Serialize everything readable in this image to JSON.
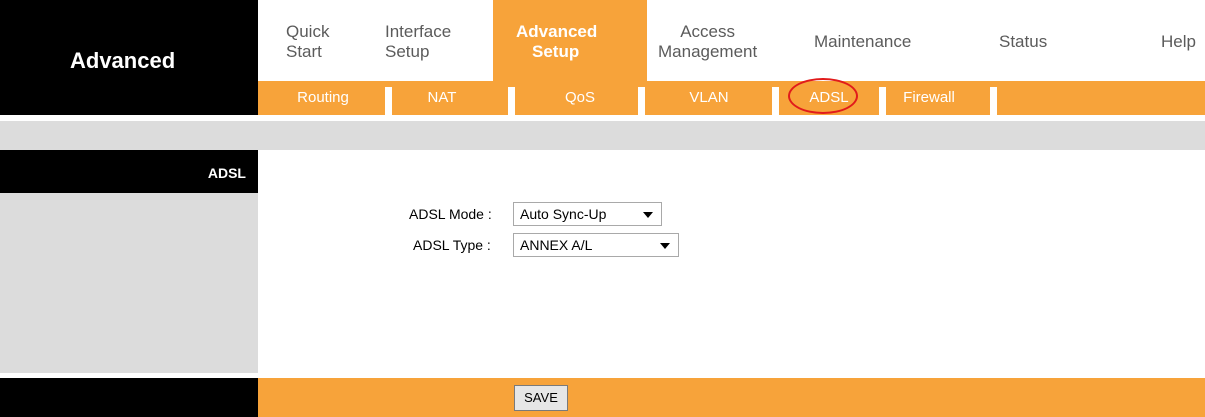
{
  "page_title": "Advanced",
  "main_menu": [
    {
      "label_line1": "Quick",
      "label_line2": "Start"
    },
    {
      "label_line1": "Interface",
      "label_line2": "Setup"
    },
    {
      "label_line1": "Advanced",
      "label_line2": "Setup"
    },
    {
      "label_line1": "Access",
      "label_line2": "Management"
    },
    {
      "label": "Maintenance"
    },
    {
      "label": "Status"
    },
    {
      "label": "Help"
    }
  ],
  "sub_menu": [
    "Routing",
    "NAT",
    "QoS",
    "VLAN",
    "ADSL",
    "Firewall"
  ],
  "section_label": "ADSL",
  "form": {
    "adsl_mode_label": "ADSL Mode :",
    "adsl_mode_value": "Auto Sync-Up",
    "adsl_type_label": "ADSL Type :",
    "adsl_type_value": "ANNEX A/L"
  },
  "save_label": "SAVE",
  "colors": {
    "accent_orange": "#f7a33a",
    "highlight_circle": "#e11b1b",
    "band_gray": "#dcdcdc"
  }
}
